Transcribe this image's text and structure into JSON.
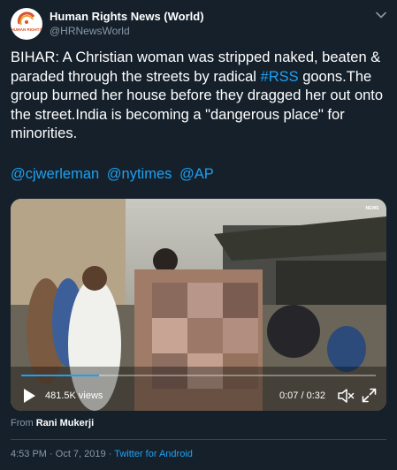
{
  "author": {
    "name": "Human Rights News (World)",
    "handle": "@HRNewsWorld",
    "avatar_text": "HUMAN RIGHTS"
  },
  "tweet": {
    "text_before": "BIHAR: A Christian woman was stripped naked, beaten & paraded through the streets by radical ",
    "hashtag": "#RSS",
    "text_after": " goons.The group burned her house before they dragged her out onto the street.India is becoming a \"dangerous place\" for minorities.",
    "mentions": [
      "@cjwerleman",
      "@nytimes",
      "@AP"
    ]
  },
  "video": {
    "views": "481.5K views",
    "time": "0:07 / 0:32",
    "progress_fraction": 0.22,
    "corner_logo": "NEWS"
  },
  "attribution": {
    "prefix": "From",
    "source": "Rani Mukerji"
  },
  "meta": {
    "time": "4:53 PM",
    "date": "Oct 7, 2019",
    "separator": "·",
    "app": "Twitter for Android"
  },
  "colors": {
    "background": "#15202b",
    "accent": "#1da1f2",
    "secondary_text": "#8899a6"
  },
  "icons": [
    "chevron-down-icon",
    "play-icon",
    "mute-icon",
    "fullscreen-icon"
  ]
}
